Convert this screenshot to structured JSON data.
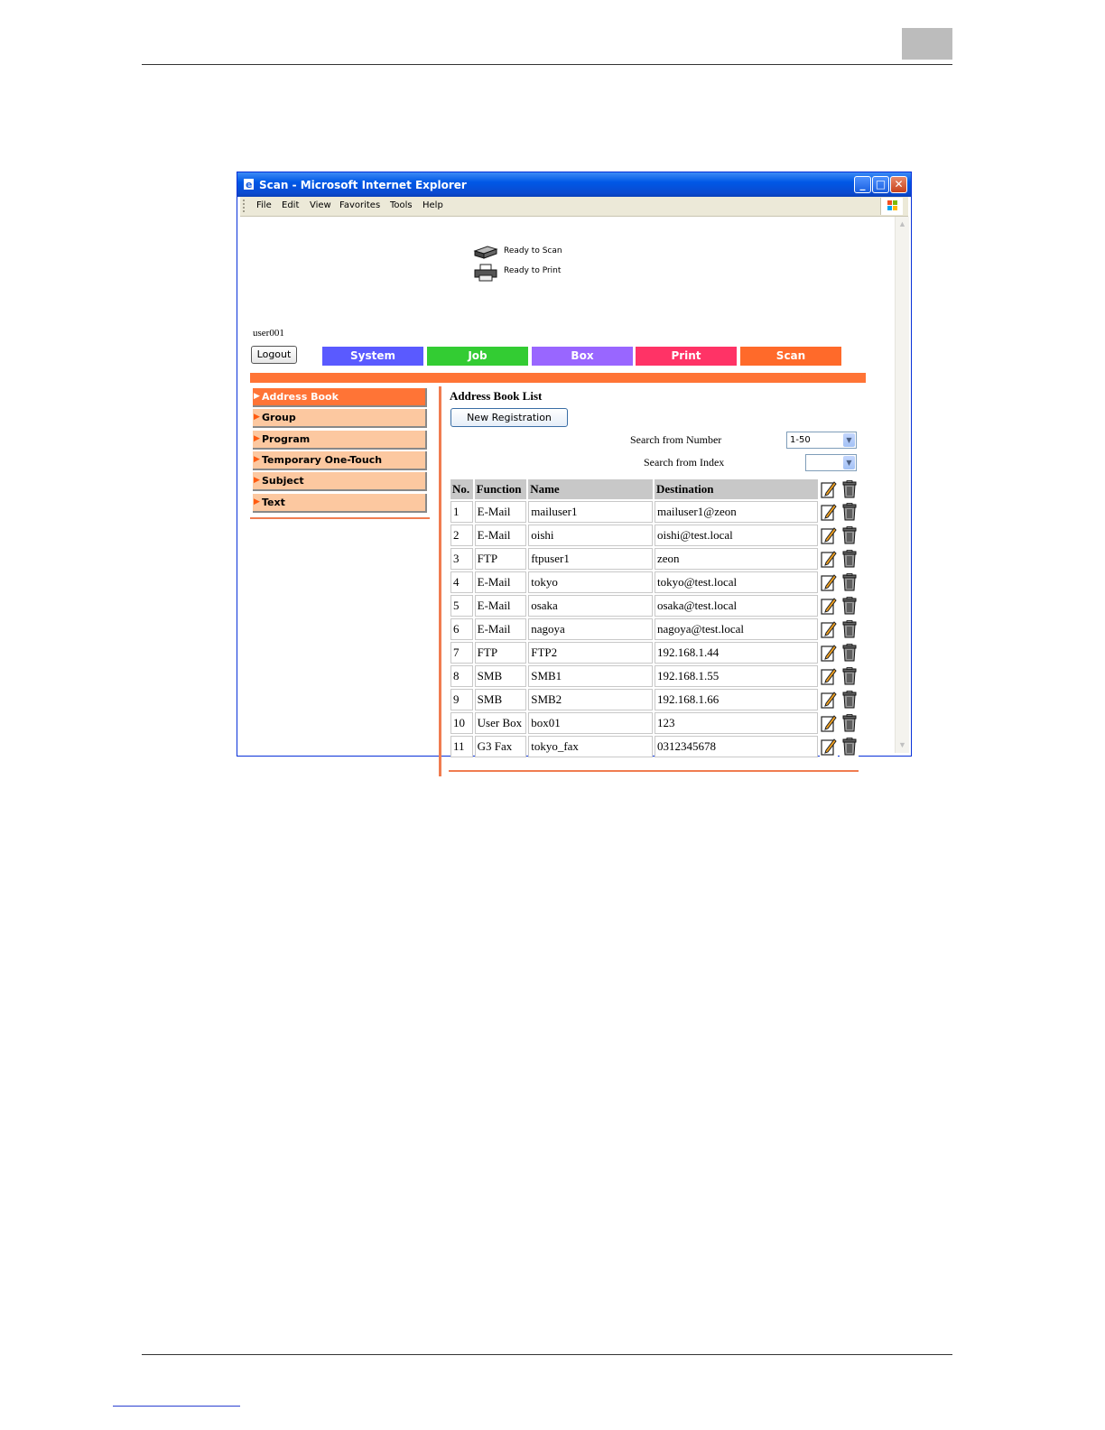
{
  "window": {
    "title": "Scan - Microsoft Internet Explorer",
    "minimize_symbol": "_",
    "maximize_symbol": "□",
    "close_symbol": "✕"
  },
  "menu": [
    "File",
    "Edit",
    "View",
    "Favorites",
    "Tools",
    "Help"
  ],
  "status": {
    "scan": "Ready to Scan",
    "print": "Ready to Print"
  },
  "user": "user001",
  "logout_label": "Logout",
  "tabs": [
    {
      "label": "System",
      "color": "#5a5aff"
    },
    {
      "label": "Job",
      "color": "#33cc33"
    },
    {
      "label": "Box",
      "color": "#9966ff"
    },
    {
      "label": "Print",
      "color": "#ff3366"
    },
    {
      "label": "Scan",
      "color": "#ff6a2a"
    }
  ],
  "sidebar": {
    "items": [
      {
        "label": "Address Book",
        "active": true
      },
      {
        "label": "Group"
      },
      {
        "label": "Program"
      },
      {
        "label": "Temporary One-Touch"
      },
      {
        "label": "Subject"
      },
      {
        "label": "Text"
      }
    ]
  },
  "main": {
    "title": "Address Book List",
    "new_registration": "New Registration",
    "search_number_label": "Search from Number",
    "search_number_value": "1-50",
    "search_index_label": "Search from Index",
    "search_index_value": ""
  },
  "table": {
    "headers": [
      "No.",
      "Function",
      "Name",
      "Destination"
    ],
    "rows": [
      [
        "1",
        "E-Mail",
        "mailuser1",
        "mailuser1@zeon"
      ],
      [
        "2",
        "E-Mail",
        "oishi",
        "oishi@test.local"
      ],
      [
        "3",
        "FTP",
        "ftpuser1",
        "zeon"
      ],
      [
        "4",
        "E-Mail",
        "tokyo",
        "tokyo@test.local"
      ],
      [
        "5",
        "E-Mail",
        "osaka",
        "osaka@test.local"
      ],
      [
        "6",
        "E-Mail",
        "nagoya",
        "nagoya@test.local"
      ],
      [
        "7",
        "FTP",
        "FTP2",
        "192.168.1.44"
      ],
      [
        "8",
        "SMB",
        "SMB1",
        "192.168.1.55"
      ],
      [
        "9",
        "SMB",
        "SMB2",
        "192.168.1.66"
      ],
      [
        "10",
        "User Box",
        "box01",
        "123"
      ],
      [
        "11",
        "G3 Fax",
        "tokyo_fax",
        "0312345678"
      ]
    ]
  },
  "colors": {
    "accent_orange": "#ff7436",
    "sidebar_bg": "#fcc8a0",
    "titlebar_blue": "#0058e6"
  },
  "icons": {
    "edit": "edit-icon",
    "delete": "trash-icon",
    "scanner": "scanner-icon",
    "printer": "printer-icon"
  }
}
